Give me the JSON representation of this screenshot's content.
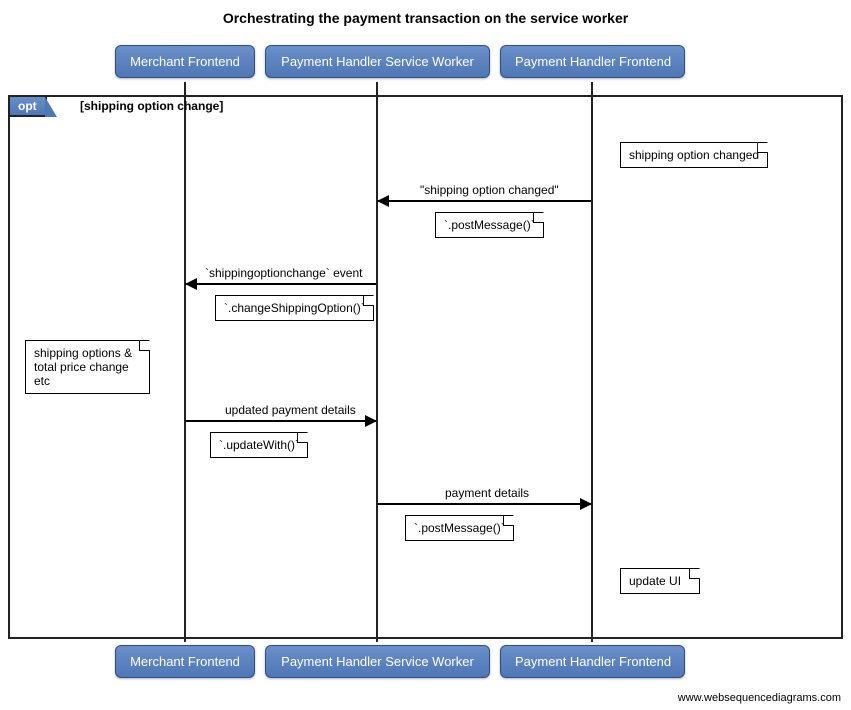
{
  "title": "Orchestrating the payment transaction on the service worker",
  "participants": {
    "p1": "Merchant Frontend",
    "p2": "Payment Handler Service Worker",
    "p3": "Payment Handler Frontend"
  },
  "opt": {
    "label": "opt",
    "guard": "[shipping option change]"
  },
  "messages": {
    "m1_label": "\"shipping option changed\"",
    "m1_note": "`.postMessage()`",
    "m2_label": "`shippingoptionchange` event",
    "m2_note": "`.changeShippingOption()`",
    "m3_label": "updated payment details",
    "m3_note": "`.updateWith()`",
    "m4_label": "payment details",
    "m4_note": "`.postMessage()`"
  },
  "notes": {
    "n1": "shipping option changed",
    "n2": "shipping options & total price change etc",
    "n3": "update UI"
  },
  "watermark": "www.websequencediagrams.com",
  "chart_data": {
    "type": "sequence-diagram",
    "title": "Orchestrating the payment transaction on the service worker",
    "participants": [
      "Merchant Frontend",
      "Payment Handler Service Worker",
      "Payment Handler Frontend"
    ],
    "fragments": [
      {
        "type": "opt",
        "guard": "shipping option change",
        "steps": [
          {
            "type": "note",
            "over": "Payment Handler Frontend",
            "text": "shipping option changed"
          },
          {
            "type": "message",
            "from": "Payment Handler Frontend",
            "to": "Payment Handler Service Worker",
            "label": "\"shipping option changed\"",
            "call": ".postMessage()"
          },
          {
            "type": "message",
            "from": "Payment Handler Service Worker",
            "to": "Merchant Frontend",
            "label": "shippingoptionchange event",
            "call": ".changeShippingOption()"
          },
          {
            "type": "note",
            "over": "Merchant Frontend",
            "text": "shipping options & total price change etc"
          },
          {
            "type": "message",
            "from": "Merchant Frontend",
            "to": "Payment Handler Service Worker",
            "label": "updated payment details",
            "call": ".updateWith()"
          },
          {
            "type": "message",
            "from": "Payment Handler Service Worker",
            "to": "Payment Handler Frontend",
            "label": "payment details",
            "call": ".postMessage()"
          },
          {
            "type": "note",
            "over": "Payment Handler Frontend",
            "text": "update UI"
          }
        ]
      }
    ]
  }
}
